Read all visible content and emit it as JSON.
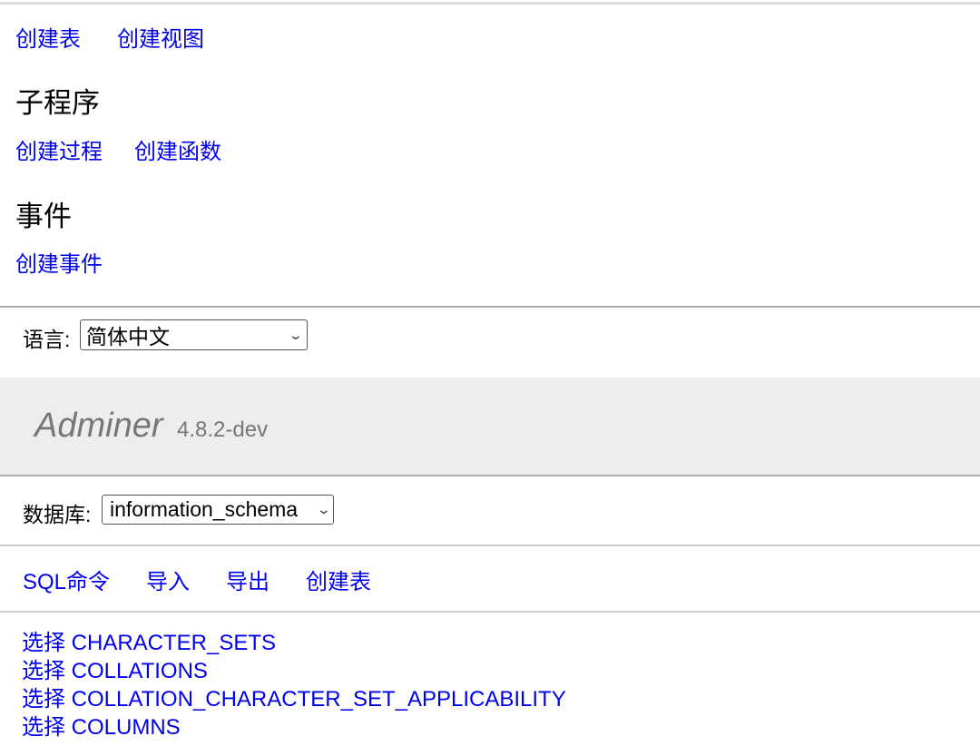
{
  "tables_links": [
    "创建表",
    "创建视图"
  ],
  "routines": {
    "heading": "子程序",
    "links": [
      "创建过程",
      "创建函数"
    ]
  },
  "events": {
    "heading": "事件",
    "links": [
      "创建事件"
    ]
  },
  "language": {
    "label": "语言:",
    "selected": "简体中文"
  },
  "logo": {
    "name": "Adminer",
    "version": "4.8.2-dev"
  },
  "database": {
    "label": "数据库:",
    "selected": "information_schema"
  },
  "nav_links": [
    "SQL命令",
    "导入",
    "导出",
    "创建表"
  ],
  "table_list": [
    "选择 CHARACTER_SETS",
    "选择 COLLATIONS",
    "选择 COLLATION_CHARACTER_SET_APPLICABILITY",
    "选择 COLUMNS"
  ]
}
